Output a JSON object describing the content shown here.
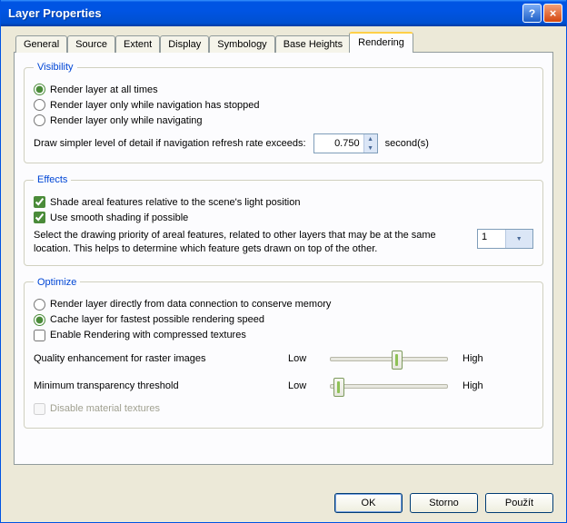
{
  "window": {
    "title": "Layer Properties"
  },
  "tabs": {
    "t0": "General",
    "t1": "Source",
    "t2": "Extent",
    "t3": "Display",
    "t4": "Symbology",
    "t5": "Base Heights",
    "t6": "Rendering"
  },
  "visibility": {
    "legend": "Visibility",
    "opt_all": "Render layer at all times",
    "opt_stopped": "Render layer only while navigation has stopped",
    "opt_nav": "Render layer only while navigating",
    "detail_label": "Draw simpler level of detail if navigation refresh rate exceeds:",
    "detail_val": "0.750",
    "detail_unit": "second(s)"
  },
  "effects": {
    "legend": "Effects",
    "chk_shade": "Shade areal features relative to the scene's light position",
    "chk_smooth": "Use smooth shading if possible",
    "priority_text": "Select the drawing priority of areal features, related to other layers that may be at the same location. This helps to determine which feature gets drawn on top of the other.",
    "priority_val": "1"
  },
  "optimize": {
    "legend": "Optimize",
    "opt_direct": "Render layer directly from data connection to conserve memory",
    "opt_cache": "Cache layer for fastest possible rendering speed",
    "chk_compressed": "Enable Rendering with compressed textures",
    "quality_label": "Quality enhancement for raster images",
    "trans_label": "Minimum transparency threshold",
    "low": "Low",
    "high": "High",
    "chk_disable": "Disable material textures"
  },
  "buttons": {
    "ok": "OK",
    "cancel": "Storno",
    "apply": "Použít"
  }
}
